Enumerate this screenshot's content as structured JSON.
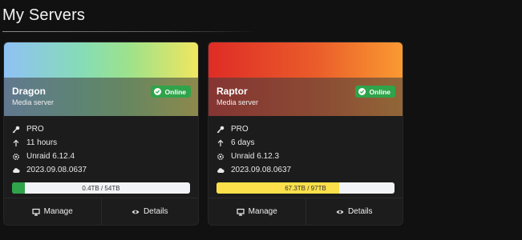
{
  "page": {
    "title": "My Servers"
  },
  "colors": {
    "background": "#111111",
    "card": "#1c1c1c",
    "online_badge": "#2fa44a",
    "progress_track": "#f1f3f6"
  },
  "servers": [
    {
      "name": "Dragon",
      "description": "Media server",
      "status": "Online",
      "license": "PRO",
      "uptime": "11 hours",
      "os_version": "Unraid 6.12.4",
      "build": "2023.09.08.0637",
      "storage_text": "0.4TB / 54TB",
      "storage_used_fraction": 0.07,
      "banner_colors": [
        "#8fc1f5",
        "#86dcb6",
        "#9ee28a",
        "#f0e660"
      ],
      "progress_color": "#2fa44a",
      "actions": {
        "manage": "Manage",
        "details": "Details"
      }
    },
    {
      "name": "Raptor",
      "description": "Media server",
      "status": "Online",
      "license": "PRO",
      "uptime": "6 days",
      "os_version": "Unraid 6.12.3",
      "build": "2023.09.08.0637",
      "storage_text": "67.3TB / 97TB",
      "storage_used_fraction": 0.69,
      "banner_colors": [
        "#df2c26",
        "#ea5c2a",
        "#fa9a32"
      ],
      "progress_color": "#fbe04c",
      "actions": {
        "manage": "Manage",
        "details": "Details"
      }
    }
  ]
}
